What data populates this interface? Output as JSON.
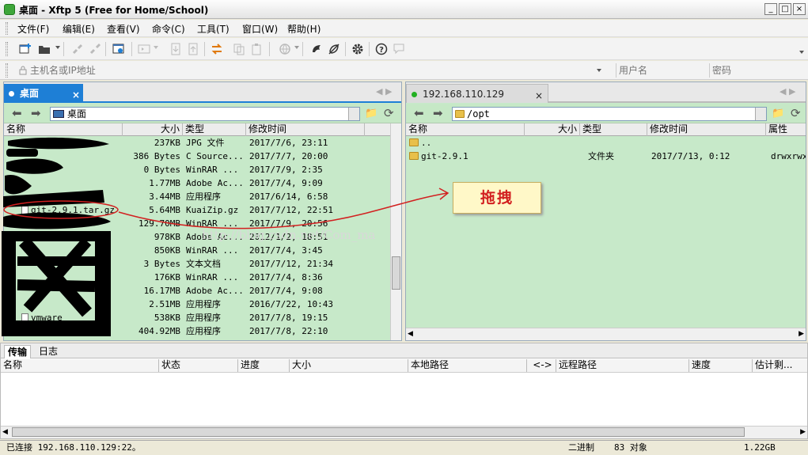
{
  "window": {
    "title": "桌面 - Xftp 5 (Free for Home/School)",
    "controls": [
      "_",
      "□",
      "×"
    ]
  },
  "menu": [
    "文件(F)",
    "编辑(E)",
    "查看(V)",
    "命令(C)",
    "工具(T)",
    "窗口(W)",
    "帮助(H)"
  ],
  "toolbar": {
    "icons": [
      "new-session-icon",
      "open-folder-icon",
      "connect-icon",
      "disconnect-icon",
      "properties-icon",
      "transfer-icon",
      "sync-icon",
      "download-icon",
      "upload-icon",
      "globe-icon",
      "ssh-shell-icon",
      "xshell-icon",
      "gear-icon",
      "help-icon",
      "chat-icon"
    ]
  },
  "address": {
    "host_placeholder": "主机名或IP地址",
    "user_placeholder": "用户名",
    "pass_placeholder": "密码"
  },
  "left": {
    "tab": "桌面",
    "path": "桌面",
    "headers": [
      "名称",
      "大小",
      "类型",
      "修改时间"
    ],
    "rows": [
      {
        "name": "",
        "size": "237KB",
        "type": "JPG 文件",
        "mtime": "2017/7/6, 23:11"
      },
      {
        "name": "",
        "size": "386 Bytes",
        "type": "C Source...",
        "mtime": "2017/7/7, 20:00"
      },
      {
        "name": "",
        "size": "0 Bytes",
        "type": "WinRAR ...",
        "mtime": "2017/7/9, 2:35"
      },
      {
        "name": "",
        "size": "1.77MB",
        "type": "Adobe Ac...",
        "mtime": "2017/7/4, 9:09"
      },
      {
        "name": "",
        "size": "3.44MB",
        "type": "应用程序",
        "mtime": "2017/6/14, 6:58"
      },
      {
        "name": "git-2.9.1.tar.gz",
        "size": "5.64MB",
        "type": "KuaiZip.gz",
        "mtime": "2017/7/12, 22:51"
      },
      {
        "name": "",
        "size": "129.70MB",
        "type": "WinRAR ...",
        "mtime": "2017/7/9, 20:56"
      },
      {
        "name": "",
        "size": "978KB",
        "type": "Adobe Ac...",
        "mtime": "2012/1/2, 18:51"
      },
      {
        "name": "",
        "size": "850KB",
        "type": "WinRAR ...",
        "mtime": "2017/7/4, 3:45"
      },
      {
        "name": "",
        "size": "3 Bytes",
        "type": "文本文档",
        "mtime": "2017/7/12, 21:34"
      },
      {
        "name": "",
        "size": "176KB",
        "type": "WinRAR ...",
        "mtime": "2017/7/4, 8:36"
      },
      {
        "name": "",
        "size": "16.17MB",
        "type": "Adobe Ac...",
        "mtime": "2017/7/4, 9:08"
      },
      {
        "name": "",
        "size": "2.51MB",
        "type": "应用程序",
        "mtime": "2016/7/22, 10:43"
      },
      {
        "name": "vmware",
        "size": "538KB",
        "type": "应用程序",
        "mtime": "2017/7/8, 19:15"
      },
      {
        "name": "",
        "size": "404.92MB",
        "type": "应用程序",
        "mtime": "2017/7/8, 22:10"
      }
    ]
  },
  "right": {
    "tab": "192.168.110.129",
    "path": "/opt",
    "headers": [
      "名称",
      "大小",
      "类型",
      "修改时间",
      "属性"
    ],
    "rows": [
      {
        "name": "..",
        "size": "",
        "type": "",
        "mtime": "",
        "attr": ""
      },
      {
        "name": "git-2.9.1",
        "size": "",
        "type": "文件夹",
        "mtime": "2017/7/13, 0:12",
        "attr": "drwxrwxr"
      }
    ]
  },
  "annotation": {
    "callout": "拖拽",
    "watermark": "http://blog.csdn.net/Com_ma"
  },
  "transfer": {
    "tabs": [
      "传输",
      "日志"
    ],
    "headers": [
      "名称",
      "状态",
      "进度",
      "大小",
      "本地路径",
      "<->",
      "远程路径",
      "速度",
      "估计剩..."
    ]
  },
  "status": {
    "connection": "已连接 192.168.110.129:22。",
    "mode": "二进制",
    "objects": "83 对象",
    "size": "1.22GB"
  },
  "colors": {
    "accent": "#1e7fd6",
    "list_bg": "#c7e9c9",
    "connected_dot": "#22b022",
    "annotation_red": "#d22020"
  }
}
